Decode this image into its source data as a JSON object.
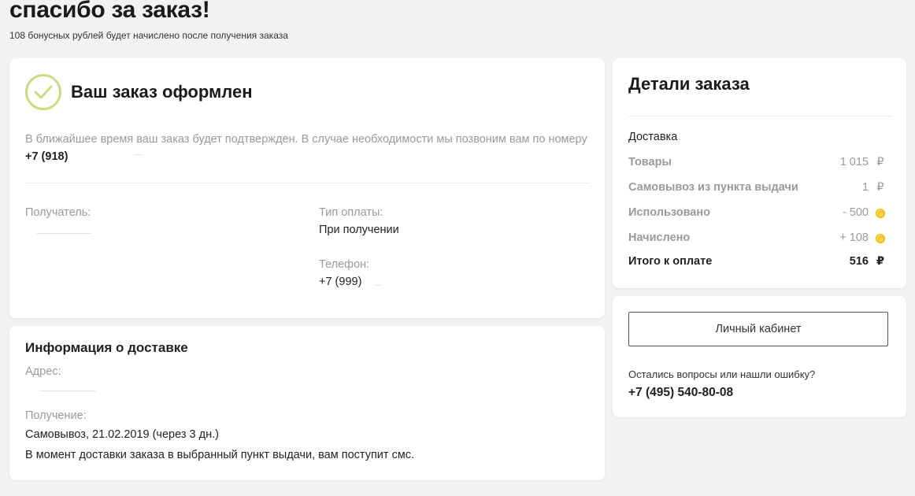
{
  "header": {
    "title": "спасибо за заказ!",
    "subtitle": "108 бонусных рублей будет начислено после получения заказа"
  },
  "status": {
    "title": "Ваш заказ оформлен",
    "message": "В ближайшее время ваш заказ будет подтвержден. В случае необходимости мы позвоним вам по номеру",
    "phone_prefix": "+7 (918)",
    "recipient_label": "Получатель:",
    "payment_label": "Тип оплаты:",
    "payment_value": "При получении",
    "phone_label": "Телефон:",
    "phone_value": "+7 (999)"
  },
  "delivery": {
    "title": "Информация о доставке",
    "address_label": "Адрес:",
    "receipt_label": "Получение:",
    "receipt_value": "Самовывоз, 21.02.2019 (через 3 дн.)",
    "note": "В момент доставки заказа в выбранный пункт выдачи, вам поступит смс."
  },
  "details": {
    "title": "Детали заказа",
    "section": "Доставка",
    "lines": [
      {
        "label": "Товары",
        "value": "1 015",
        "sign": "₽",
        "icon": null
      },
      {
        "label": "Самовывоз из пункта выдачи",
        "value": "1",
        "sign": "₽",
        "icon": null
      },
      {
        "label": "Использовано",
        "value": "- 500",
        "sign": "",
        "icon": "bonus-coin-icon"
      },
      {
        "label": "Начислено",
        "value": "+ 108",
        "sign": "",
        "icon": "bonus-coin-icon"
      }
    ],
    "total": {
      "label": "Итого к оплате",
      "value": "516",
      "sign": "₽"
    }
  },
  "account": {
    "button_label": "Личный кабинет",
    "help_text": "Остались вопросы или нашли ошибку?",
    "help_phone": "+7 (495) 540-80-08"
  },
  "colors": {
    "check_accent": "#c8dc80",
    "coin": "#ffd84d",
    "muted_text": "#9a9a9a",
    "background": "#f2f2f2"
  }
}
